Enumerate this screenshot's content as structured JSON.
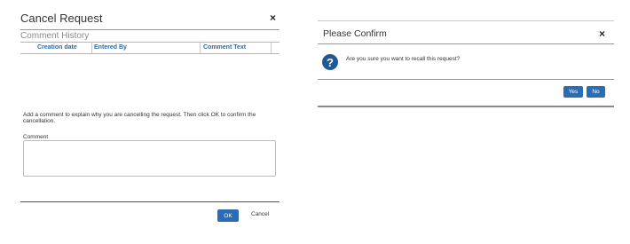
{
  "cancel_dialog": {
    "title": "Cancel Request",
    "close_glyph": "×",
    "history_title": "Comment History",
    "columns": [
      "Creation date",
      "Entered By",
      "Comment Text"
    ],
    "instruction": "Add a comment to explain why you are cancelling the request. Then click OK to confirm the cancellation.",
    "comment_label": "Comment",
    "comment_value": "",
    "ok_label": "OK",
    "cancel_label": "Cancel"
  },
  "confirm_dialog": {
    "title": "Please Confirm",
    "close_glyph": "×",
    "icon_glyph": "?",
    "message": "Are you sure you want to recall this request?",
    "yes_label": "Yes",
    "no_label": "No"
  },
  "colors": {
    "primary_button": "#2a6db5",
    "icon": "#1f5a96",
    "table_header_text": "#2d6aa6"
  },
  "icons": [
    "close-icon",
    "question-icon"
  ]
}
